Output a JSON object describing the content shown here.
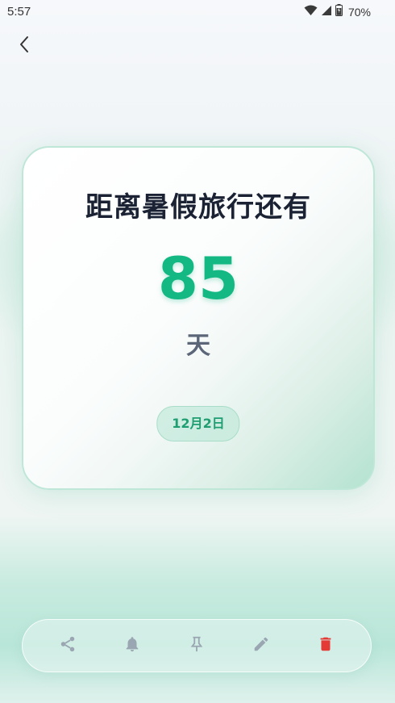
{
  "status_bar": {
    "time": "5:57",
    "battery": "70%",
    "icons": [
      "wifi-icon",
      "cell-signal-icon",
      "battery-icon"
    ]
  },
  "nav": {
    "back_icon": "back-arrow-icon"
  },
  "card": {
    "title": "距离暑假旅行还有",
    "number": "85",
    "unit": "天",
    "date": "12月2日"
  },
  "toolbar": {
    "items": [
      {
        "icon": "share-icon",
        "color": "#9aa6b2"
      },
      {
        "icon": "bell-icon",
        "color": "#9aa6b2"
      },
      {
        "icon": "pin-icon",
        "color": "#9aa6b2"
      },
      {
        "icon": "edit-icon",
        "color": "#9aa6b2"
      },
      {
        "icon": "delete-icon",
        "color": "#e53935"
      }
    ]
  },
  "colors": {
    "accent": "#14b882",
    "title": "#1a2233",
    "unit": "#5b6679",
    "danger": "#e53935"
  }
}
